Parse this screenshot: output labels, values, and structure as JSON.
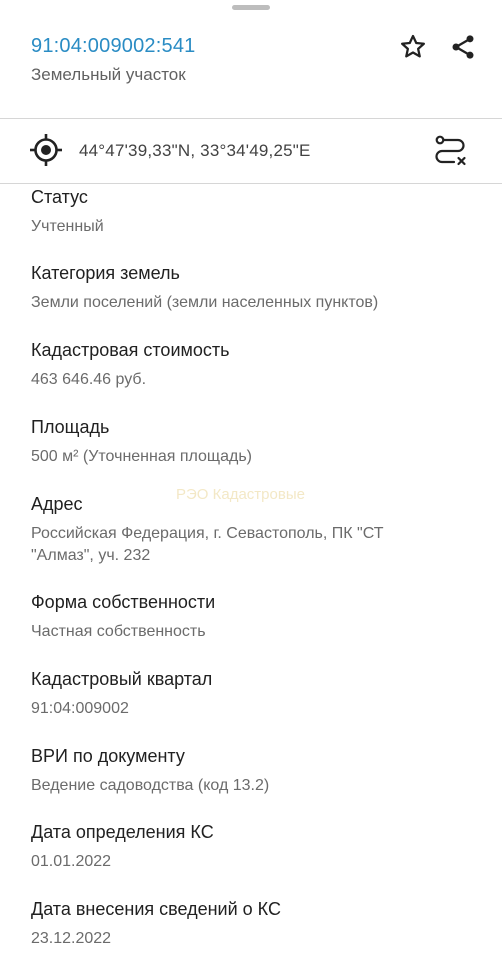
{
  "header": {
    "cadastral_number": "91:04:009002:541",
    "object_type": "Земельный участок",
    "star_icon": "star-icon",
    "share_icon": "share-icon"
  },
  "location": {
    "coordinates": "44°47'39,33\"N, 33°34'49,25\"E",
    "target_icon": "gps-target-icon",
    "route_icon": "route-icon"
  },
  "fields": [
    {
      "label": "Статус",
      "value": "Учтенный"
    },
    {
      "label": "Категория земель",
      "value": "Земли поселений (земли населенных пунктов)"
    },
    {
      "label": "Кадастровая стоимость",
      "value": "463 646.46 руб."
    },
    {
      "label": "Площадь",
      "value": "500 м² (Уточненная площадь)"
    },
    {
      "label": "Адрес",
      "value": "Российская Федерация, г. Севастополь, ПК \"СТ \"Алмаз\", уч. 232"
    },
    {
      "label": "Форма собственности",
      "value": "Частная собственность"
    },
    {
      "label": "Кадастровый квартал",
      "value": "91:04:009002"
    },
    {
      "label": "ВРИ по документу",
      "value": "Ведение садоводства (код 13.2)"
    },
    {
      "label": "Дата определения КС",
      "value": "01.01.2022"
    },
    {
      "label": "Дата внесения сведений о КС",
      "value": "23.12.2022"
    }
  ],
  "colors": {
    "accent": "#2a8cc4",
    "label_text": "#212121",
    "value_text": "#6b6b6b",
    "divider": "#d6d6d6"
  }
}
